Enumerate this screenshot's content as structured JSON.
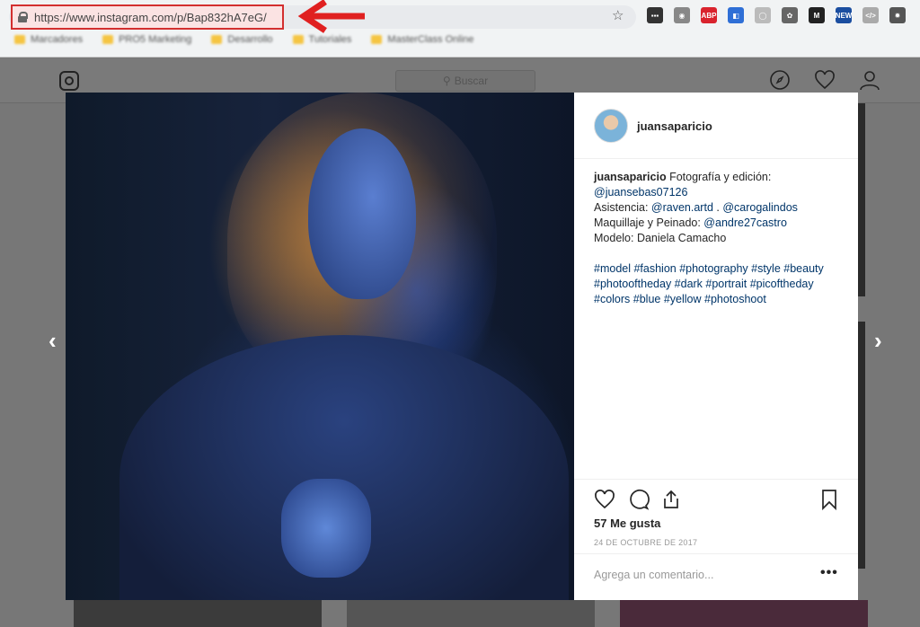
{
  "browser": {
    "url": "https://www.instagram.com/p/Bap832hA7eG/",
    "bookmarks": [
      "Marcadores",
      "PRO5 Marketing",
      "Desarrollo",
      "Tutoriales",
      "MasterClass Online"
    ],
    "extensions": [
      {
        "name": "dark-ext-icon",
        "color": "#333333",
        "label": "▪▪▪"
      },
      {
        "name": "camera-icon",
        "color": "#888888",
        "label": "◉"
      },
      {
        "name": "adblock-icon",
        "color": "#d9232d",
        "label": "ABP"
      },
      {
        "name": "blue-ext-icon",
        "color": "#2f6fd6",
        "label": "◧"
      },
      {
        "name": "grey-circle-icon",
        "color": "#bbbbbb",
        "label": "◯"
      },
      {
        "name": "gear-ext-icon",
        "color": "#666666",
        "label": "✿"
      },
      {
        "name": "m-ext-icon",
        "color": "#222222",
        "label": "M"
      },
      {
        "name": "new-ext-icon",
        "color": "#1b4ea0",
        "label": "NEW"
      },
      {
        "name": "code-ext-icon",
        "color": "#aaaaaa",
        "label": "</>"
      },
      {
        "name": "settings-ext-icon",
        "color": "#555555",
        "label": "✹"
      }
    ]
  },
  "header": {
    "search_placeholder": "Buscar"
  },
  "post": {
    "username": "juansaparicio",
    "caption_lines": [
      {
        "text": " Fotografía y edición:",
        "link": ""
      },
      {
        "text": "",
        "link": "@juansebas07126"
      }
    ],
    "caption_intro": " Fotografía y edición:",
    "photographer": "@juansebas07126",
    "assist_label": "Asistencia: ",
    "assist_1": "@raven.artd",
    "assist_sep": " . ",
    "assist_2": "@carogalindos",
    "makeup_label": "Maquillaje y Peinado: ",
    "makeup": "@andre27castro",
    "model_label": "Modelo: Daniela Camacho",
    "hashtags": "#model #fashion #photography #style #beauty #photooftheday #dark #portrait #picoftheday #colors #blue #yellow #photoshoot",
    "likes": "57 Me gusta",
    "date": "24 DE OCTUBRE DE 2017",
    "comment_placeholder": "Agrega un comentario...",
    "more": "•••"
  },
  "nav": {
    "prev": "‹",
    "next": "›"
  }
}
